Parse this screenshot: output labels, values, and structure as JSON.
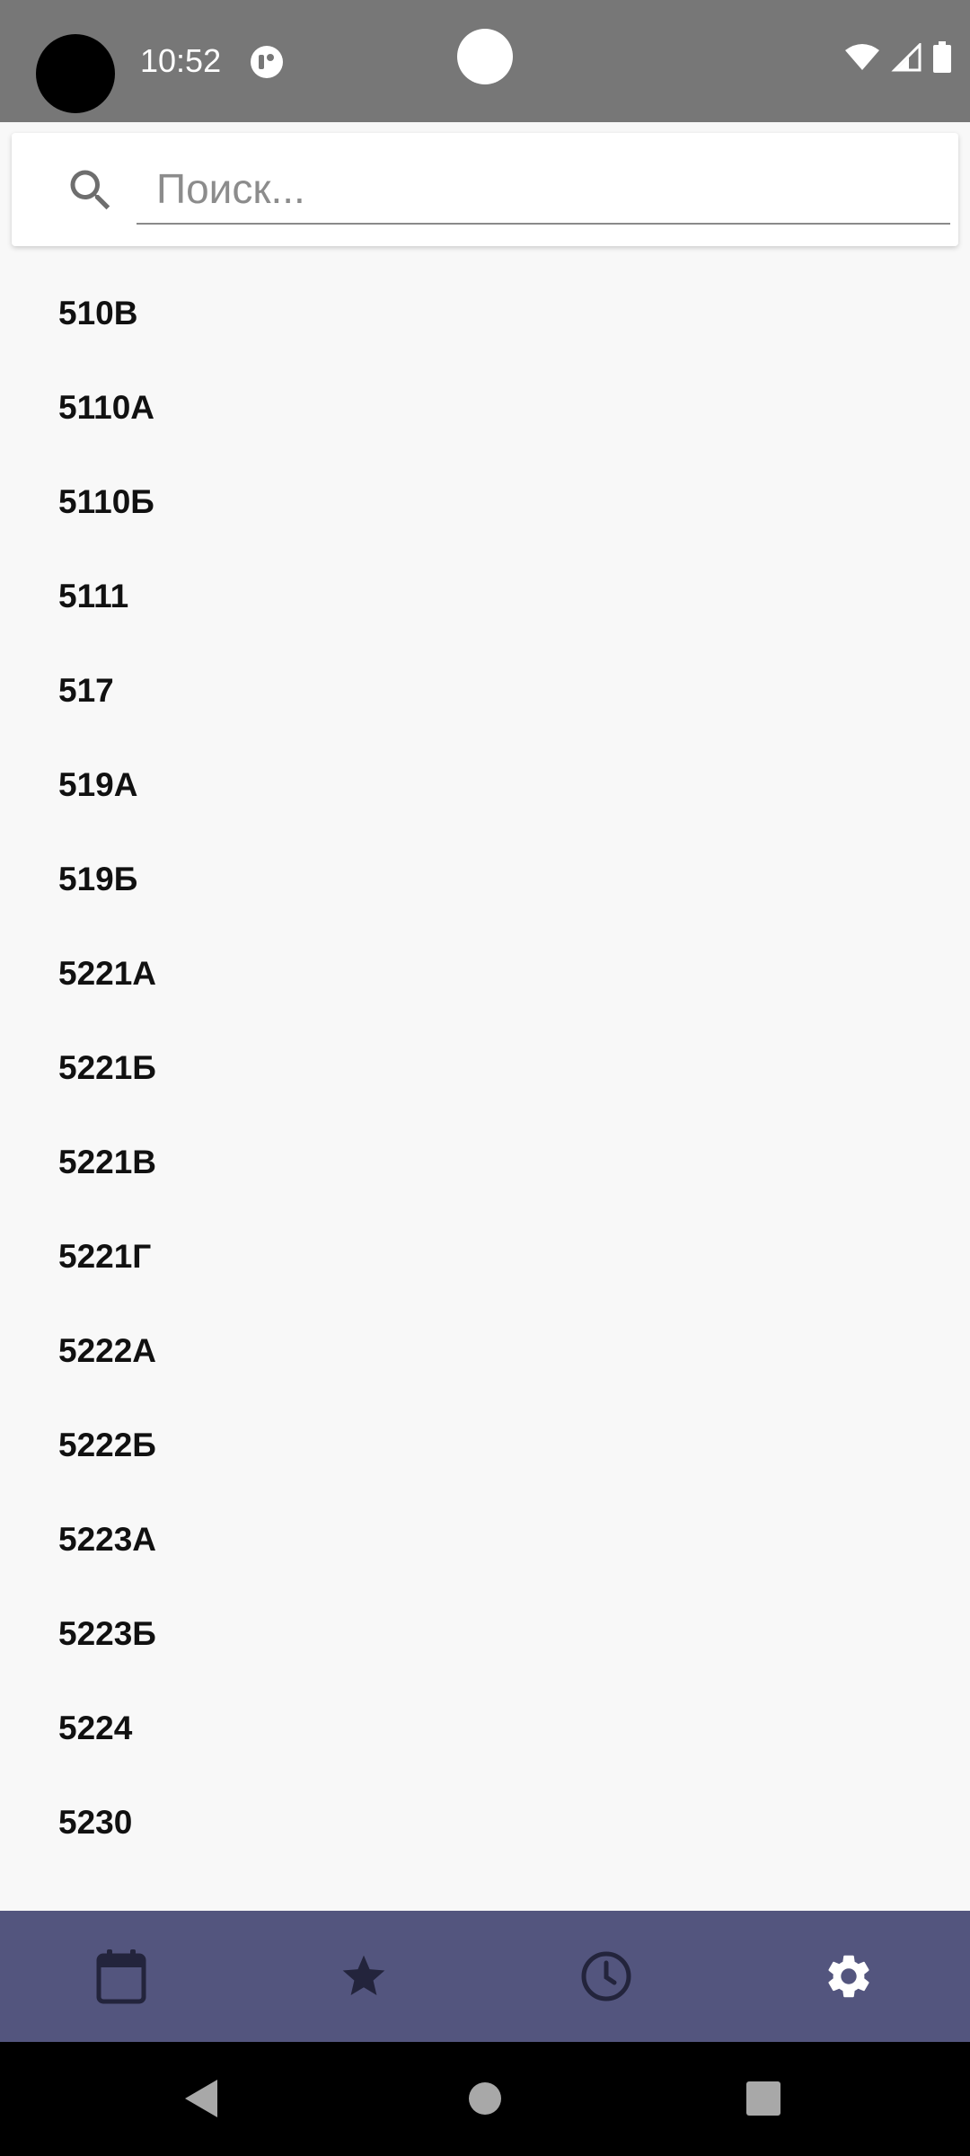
{
  "status_bar": {
    "time": "10:52"
  },
  "search": {
    "placeholder": "Поиск...",
    "value": ""
  },
  "list": {
    "items": [
      "510В",
      "5110А",
      "5110Б",
      "5111",
      "517",
      "519А",
      "519Б",
      "5221А",
      "5221Б",
      "5221В",
      "5221Г",
      "5222А",
      "5222Б",
      "5223А",
      "5223Б",
      "5224",
      "5230"
    ]
  },
  "bottom_nav": {
    "items": [
      {
        "icon": "calendar-icon",
        "active": false
      },
      {
        "icon": "star-icon",
        "active": false
      },
      {
        "icon": "clock-icon",
        "active": false
      },
      {
        "icon": "gear-icon",
        "active": true
      }
    ]
  },
  "colors": {
    "status_bar": "#777777",
    "background": "#f8f8f8",
    "bottom_nav": "#53557e",
    "nav_icon_inactive": "#23243c",
    "nav_icon_active": "#ffffff",
    "list_text": "#111111"
  }
}
